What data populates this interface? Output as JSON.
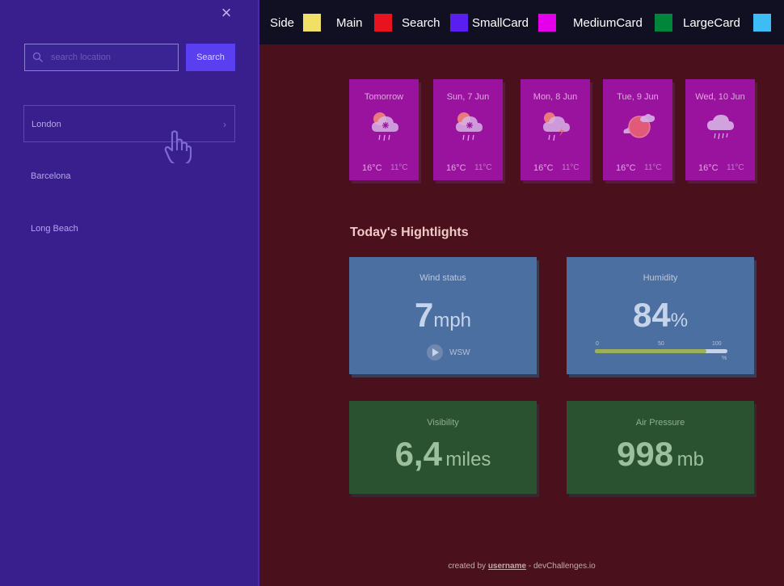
{
  "sidebar": {
    "close_label": "×",
    "search_placeholder": "search location",
    "search_button": "Search",
    "locations": [
      {
        "name": "London"
      },
      {
        "name": "Barcelona"
      },
      {
        "name": "Long Beach"
      }
    ]
  },
  "legend": {
    "items": [
      {
        "label": "Side",
        "color": "#f0e068"
      },
      {
        "label": "Main",
        "color": "#e8131e"
      },
      {
        "label": "Search",
        "color": "#5a1ff0"
      },
      {
        "label": "SmallCard",
        "color": "#e400ea"
      },
      {
        "label": "MediumCard",
        "color": "#00853a"
      },
      {
        "label": "LargeCard",
        "color": "#3dbcf5"
      }
    ]
  },
  "forecast": [
    {
      "day": "Tomorrow",
      "icon": "sleet-icon",
      "hi": "16°C",
      "lo": "11°C"
    },
    {
      "day": "Sun, 7 Jun",
      "icon": "sleet-icon",
      "hi": "16°C",
      "lo": "11°C"
    },
    {
      "day": "Mon, 8 Jun",
      "icon": "thunderstorm-icon",
      "hi": "16°C",
      "lo": "11°C"
    },
    {
      "day": "Tue, 9 Jun",
      "icon": "partly-cloudy-icon",
      "hi": "16°C",
      "lo": "11°C"
    },
    {
      "day": "Wed, 10 Jun",
      "icon": "rain-icon",
      "hi": "16°C",
      "lo": "11°C"
    }
  ],
  "highlights": {
    "title": "Today's Hightlights",
    "wind": {
      "title": "Wind status",
      "value": "7",
      "unit": "mph",
      "direction": "WSW"
    },
    "humidity": {
      "title": "Humidity",
      "value": "84",
      "unit": "%",
      "scale": [
        "0",
        "50",
        "100"
      ],
      "scale_unit": "%",
      "percent": 84
    },
    "visibility": {
      "title": "Visibility",
      "value": "6,4",
      "unit": "miles"
    },
    "pressure": {
      "title": "Air Pressure",
      "value": "998",
      "unit": "mb"
    }
  },
  "footer": {
    "prefix": "created by",
    "username": "username",
    "suffix": "- devChallenges.io"
  }
}
